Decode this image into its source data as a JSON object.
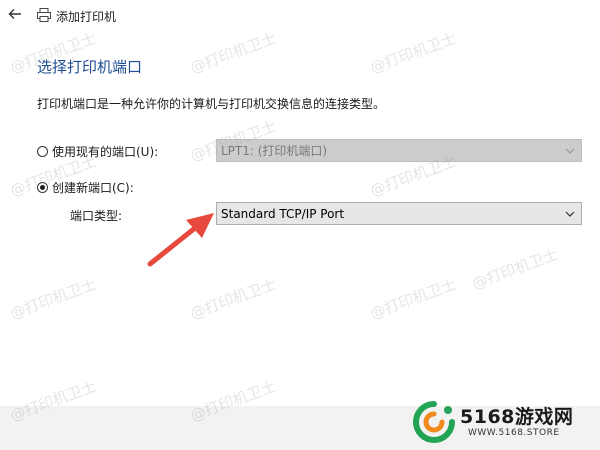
{
  "window": {
    "title": "添加打印机",
    "back_icon": "back-arrow-icon",
    "app_icon": "printer-icon"
  },
  "page": {
    "heading": "选择打印机端口",
    "description": "打印机端口是一种允许你的计算机与打印机交换信息的连接类型。"
  },
  "options": {
    "existing_port": {
      "label": "使用现有的端口(U):",
      "checked": false,
      "select_value": "LPT1: (打印机端口)",
      "disabled": true
    },
    "create_port": {
      "label": "创建新端口(C):",
      "checked": true
    },
    "port_type": {
      "label": "端口类型:",
      "select_value": "Standard TCP/IP Port"
    }
  },
  "annotation": {
    "arrow_color": "#e8493f"
  },
  "watermark": {
    "text": "@打印机卫士"
  },
  "branding": {
    "logo_text": "5168游戏网",
    "logo_url": "WWW.5168.STORE"
  },
  "colors": {
    "heading": "#1f4e96",
    "logo_green": "#23a455",
    "logo_orange": "#f08a1c"
  }
}
